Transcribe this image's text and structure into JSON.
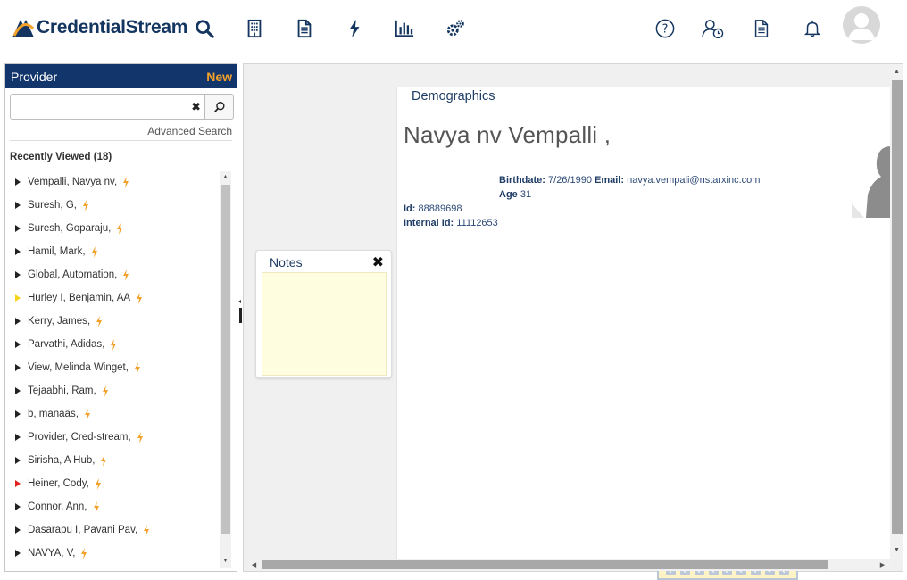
{
  "brand": {
    "name": "CredentialStream"
  },
  "nav": {
    "icons": [
      "search-icon",
      "building-icon",
      "document-icon",
      "lightning-icon",
      "bar-chart-icon",
      "settings-gears-icon"
    ],
    "right_icons": [
      "help-icon",
      "user-clock-icon",
      "report-icon",
      "bell-icon",
      "user-avatar"
    ]
  },
  "left_panel": {
    "title": "Provider",
    "new_label": "New",
    "search": {
      "value": "",
      "placeholder": ""
    },
    "advanced_search": "Advanced Search",
    "recent_title": "Recently Viewed (18)",
    "items": [
      {
        "label": "Vempalli, Navya nv,",
        "marker": "#222222"
      },
      {
        "label": "Suresh, G,",
        "marker": "#222222"
      },
      {
        "label": "Suresh, Goparaju,",
        "marker": "#222222"
      },
      {
        "label": "Hamil, Mark,",
        "marker": "#222222"
      },
      {
        "label": "Global, Automation,",
        "marker": "#222222"
      },
      {
        "label": "Hurley I, Benjamin, AA",
        "marker": "#f7d417"
      },
      {
        "label": "Kerry, James,",
        "marker": "#222222"
      },
      {
        "label": "Parvathi, Adidas,",
        "marker": "#222222"
      },
      {
        "label": "View, Melinda Winget,",
        "marker": "#222222"
      },
      {
        "label": "Tejaabhi, Ram,",
        "marker": "#222222"
      },
      {
        "label": "b, manaas,",
        "marker": "#222222"
      },
      {
        "label": "Provider, Cred-stream,",
        "marker": "#222222"
      },
      {
        "label": "Sirisha, A Hub,",
        "marker": "#222222"
      },
      {
        "label": "Heiner, Cody,",
        "marker": "#e0201c"
      },
      {
        "label": "Connor, Ann,",
        "marker": "#222222"
      },
      {
        "label": "Dasarapu I, Pavani Pav,",
        "marker": "#222222"
      },
      {
        "label": "NAVYA, V,",
        "marker": "#222222"
      }
    ]
  },
  "notes": {
    "title": "Notes",
    "value": ""
  },
  "demographics": {
    "title": "Demographics",
    "name": "Navya nv Vempalli ,",
    "birthdate_label": "Birthdate:",
    "birthdate": "7/26/1990",
    "email_label": "Email:",
    "email": "navya.vempali@nstarxinc.com",
    "age_label": "Age",
    "age": "31",
    "id_label": "Id:",
    "id": "88889698",
    "internal_id_label": "Internal Id:",
    "internal_id": "11112653"
  },
  "colors": {
    "header_blue": "#12356b",
    "accent_orange": "#f3a12a",
    "link_blue": "#2c4a76"
  }
}
